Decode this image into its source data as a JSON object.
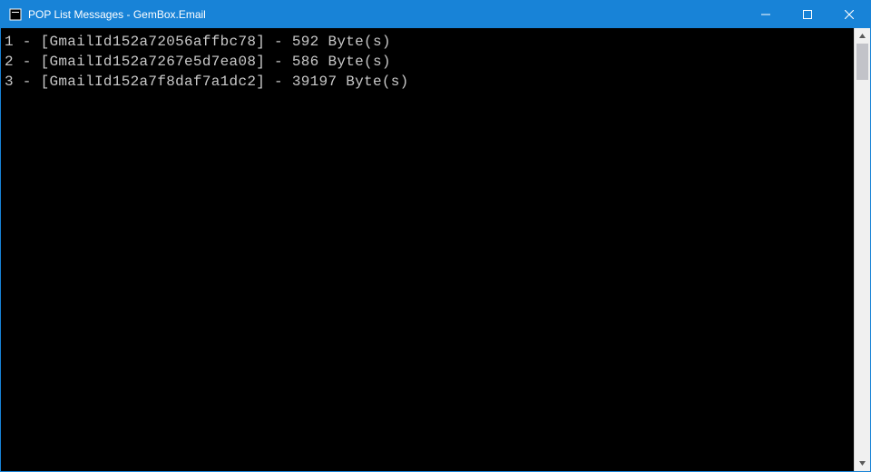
{
  "window": {
    "title": "POP List Messages - GemBox.Email"
  },
  "console": {
    "lines": [
      "1 - [GmailId152a72056affbc78] - 592 Byte(s)",
      "2 - [GmailId152a7267e5d7ea08] - 586 Byte(s)",
      "3 - [GmailId152a7f8daf7a1dc2] - 39197 Byte(s)"
    ]
  }
}
